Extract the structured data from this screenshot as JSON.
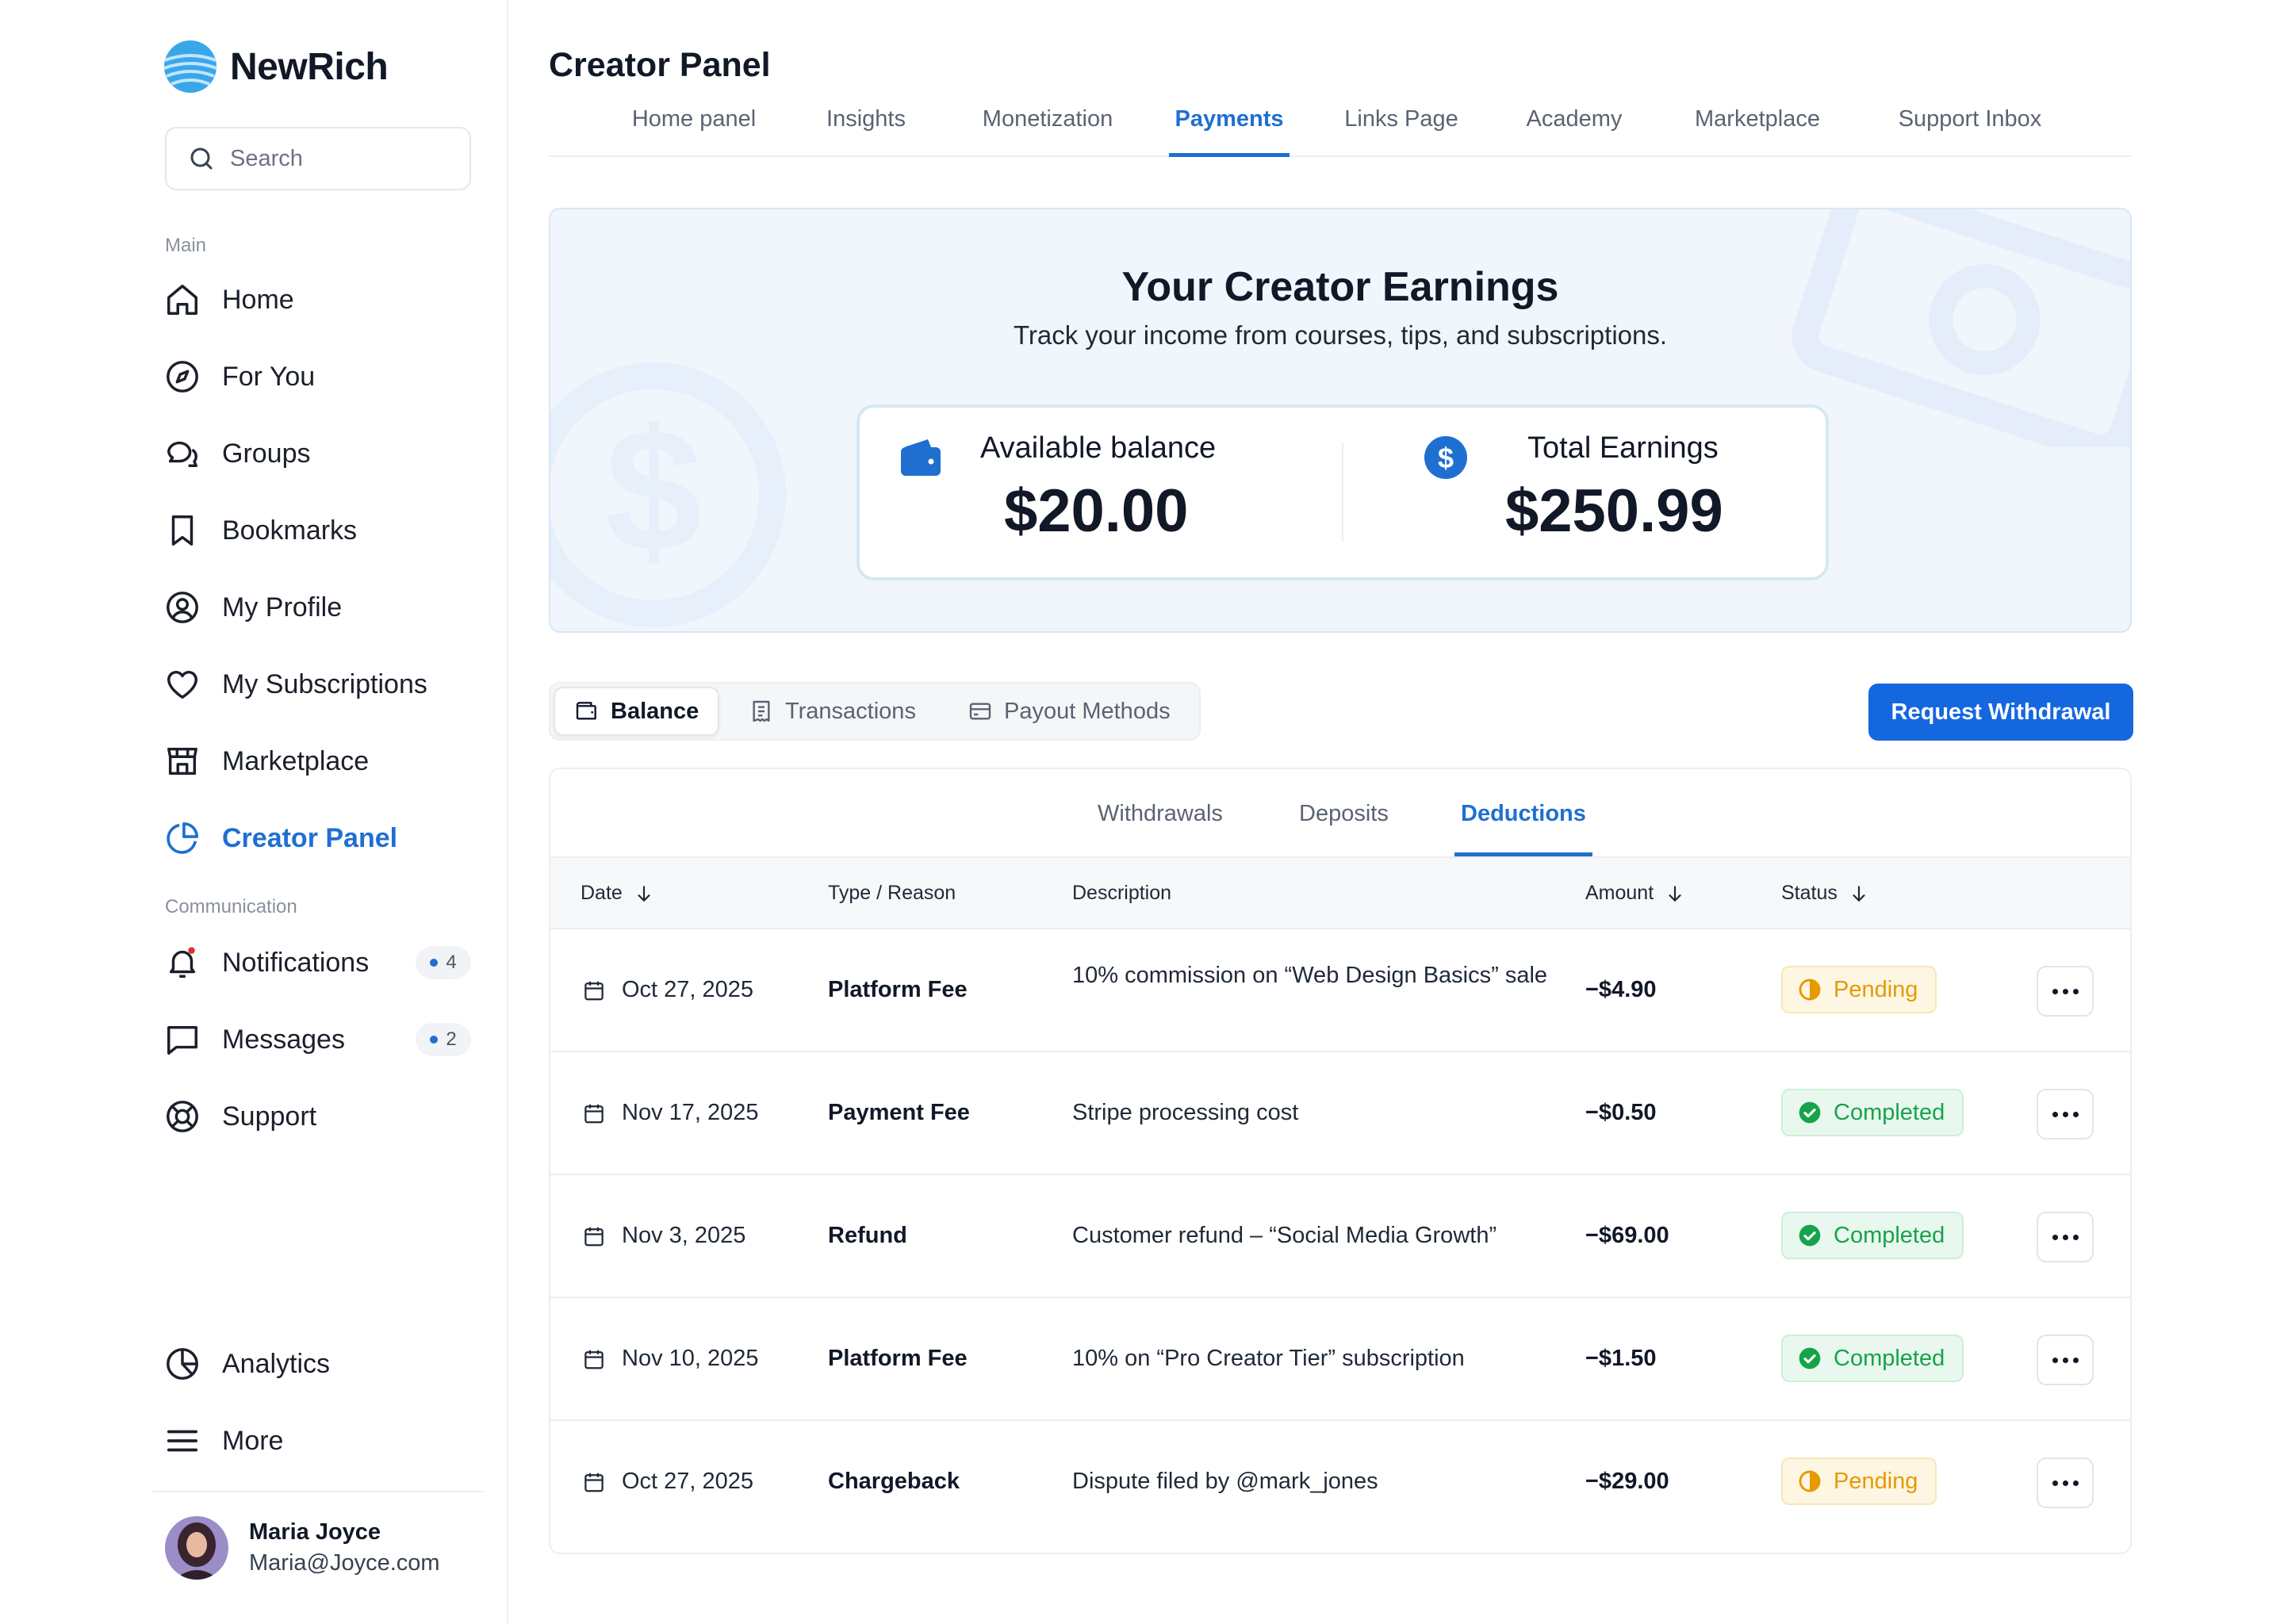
{
  "brand": {
    "name": "NewRich"
  },
  "search": {
    "placeholder": "Search"
  },
  "sidebar": {
    "main_caption": "Main",
    "main_items": [
      {
        "label": "Home",
        "icon": "home-icon"
      },
      {
        "label": "For You",
        "icon": "compass-icon"
      },
      {
        "label": "Groups",
        "icon": "chat-bubbles-icon"
      },
      {
        "label": "Bookmarks",
        "icon": "bookmark-icon"
      },
      {
        "label": "My Profile",
        "icon": "user-circle-icon"
      },
      {
        "label": "My Subscriptions",
        "icon": "heart-icon"
      },
      {
        "label": "Marketplace",
        "icon": "store-icon"
      },
      {
        "label": "Creator Panel",
        "icon": "pie-chart-icon",
        "active": true
      }
    ],
    "communication_caption": "Communication",
    "communication_items": [
      {
        "label": "Notifications",
        "icon": "bell-icon",
        "count": "4"
      },
      {
        "label": "Messages",
        "icon": "message-square-icon",
        "count": "2"
      },
      {
        "label": "Support",
        "icon": "lifebuoy-icon"
      }
    ],
    "bottom_items": [
      {
        "label": "Analytics",
        "icon": "pie-chart-icon"
      },
      {
        "label": "More",
        "icon": "menu-icon"
      }
    ],
    "user": {
      "name": "Maria Joyce",
      "email": "Maria@Joyce.com"
    }
  },
  "header": {
    "title": "Creator Panel",
    "tabs": [
      "Home panel",
      "Insights",
      "Monetization",
      "Payments",
      "Links Page",
      "Academy",
      "Marketplace",
      "Support Inbox"
    ],
    "active_tab": "Payments"
  },
  "hero": {
    "title": "Your Creator Earnings",
    "subtitle": "Track your income from courses, tips, and subscriptions.",
    "available_label": "Available balance",
    "available_value": "$20.00",
    "total_label": "Total Earnings",
    "total_value": "$250.99"
  },
  "segments": {
    "items": [
      "Balance",
      "Transactions",
      "Payout Methods"
    ],
    "active": "Balance"
  },
  "withdraw_button": "Request Withdrawal",
  "subtabs": {
    "items": [
      "Withdrawals",
      "Deposits",
      "Deductions"
    ],
    "active": "Deductions"
  },
  "table": {
    "headers": {
      "date": "Date",
      "type": "Type / Reason",
      "description": "Description",
      "amount": "Amount",
      "status": "Status"
    },
    "rows": [
      {
        "date": "Oct 27, 2025",
        "type": "Platform Fee",
        "description": "10% commission on “Web Design Basics” sale",
        "amount": "−$4.90",
        "status": "Pending"
      },
      {
        "date": "Nov 17, 2025",
        "type": "Payment Fee",
        "description": "Stripe processing cost",
        "amount": "−$0.50",
        "status": "Completed"
      },
      {
        "date": "Nov 3, 2025",
        "type": "Refund",
        "description": "Customer refund – “Social Media Growth”",
        "amount": "−$69.00",
        "status": "Completed"
      },
      {
        "date": "Nov 10, 2025",
        "type": "Platform Fee",
        "description": "10% on “Pro Creator Tier” subscription",
        "amount": "−$1.50",
        "status": "Completed"
      },
      {
        "date": "Oct 27, 2025",
        "type": "Chargeback",
        "description": "Dispute filed by @mark_jones",
        "amount": "−$29.00",
        "status": "Pending"
      }
    ]
  },
  "colors": {
    "accent": "#1f6fd1",
    "button": "#1567e0",
    "pending": "#e69a00",
    "completed": "#16a34a"
  }
}
